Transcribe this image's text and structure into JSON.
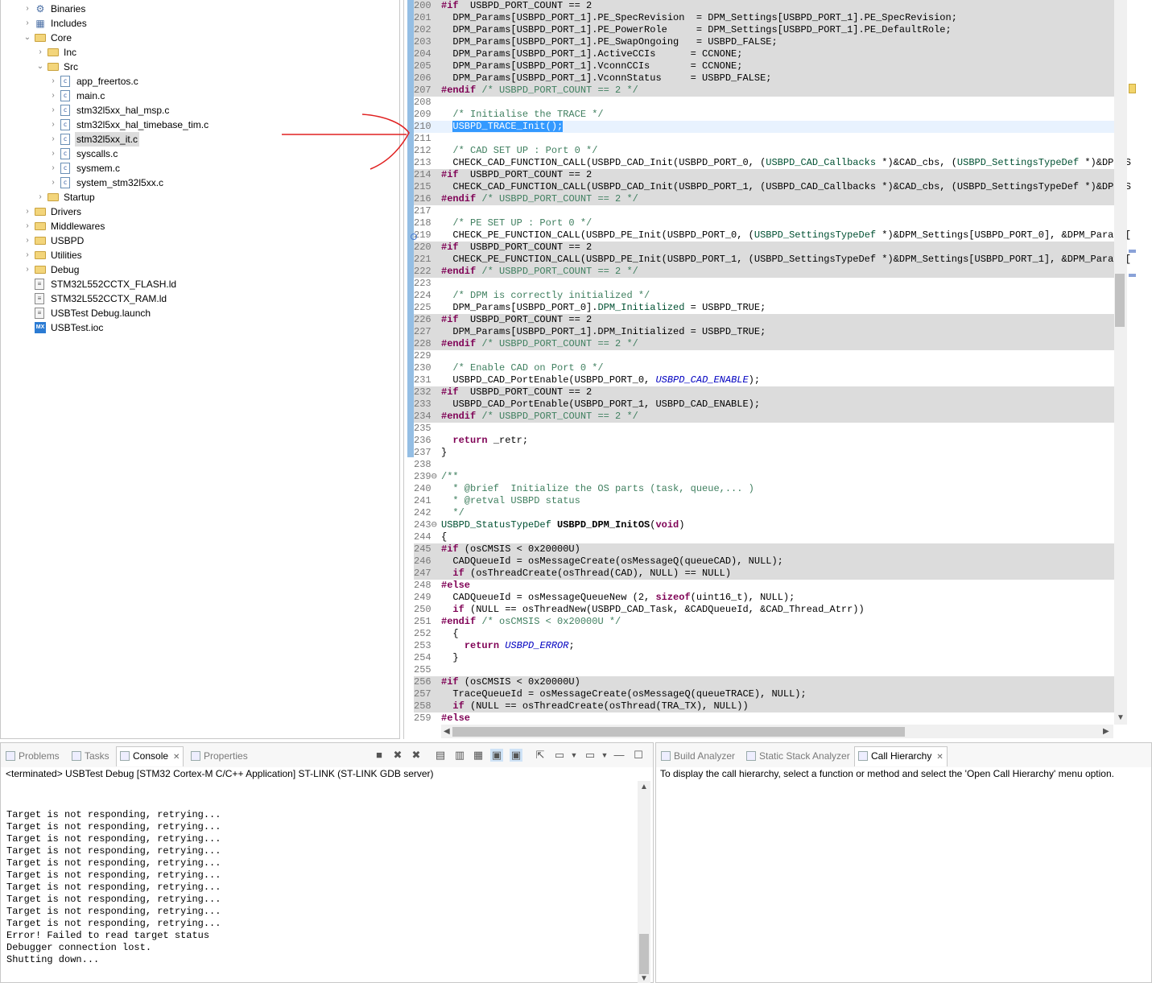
{
  "explorer": {
    "items": [
      {
        "label": "Binaries",
        "icon": "binaries-icon",
        "twisty": "closed"
      },
      {
        "label": "Includes",
        "icon": "includes-icon",
        "twisty": "closed"
      },
      {
        "label": "Core",
        "icon": "folder-icon",
        "twisty": "open"
      },
      {
        "label": "Inc",
        "icon": "folder-icon",
        "twisty": "closed"
      },
      {
        "label": "Src",
        "icon": "folder-icon",
        "twisty": "open"
      },
      {
        "label": "app_freertos.c",
        "icon": "c-file-icon",
        "twisty": "closed"
      },
      {
        "label": "main.c",
        "icon": "c-file-icon",
        "twisty": "closed"
      },
      {
        "label": "stm32l5xx_hal_msp.c",
        "icon": "c-file-icon",
        "twisty": "closed"
      },
      {
        "label": "stm32l5xx_hal_timebase_tim.c",
        "icon": "c-file-icon",
        "twisty": "closed"
      },
      {
        "label": "stm32l5xx_it.c",
        "icon": "c-file-icon",
        "twisty": "closed",
        "selected": true
      },
      {
        "label": "syscalls.c",
        "icon": "c-file-icon",
        "twisty": "closed"
      },
      {
        "label": "sysmem.c",
        "icon": "c-file-icon",
        "twisty": "closed"
      },
      {
        "label": "system_stm32l5xx.c",
        "icon": "c-file-icon",
        "twisty": "closed"
      },
      {
        "label": "Startup",
        "icon": "folder-icon",
        "twisty": "closed"
      },
      {
        "label": "Drivers",
        "icon": "folder-icon",
        "twisty": "closed"
      },
      {
        "label": "Middlewares",
        "icon": "folder-icon",
        "twisty": "closed"
      },
      {
        "label": "USBPD",
        "icon": "folder-icon",
        "twisty": "closed"
      },
      {
        "label": "Utilities",
        "icon": "folder-icon",
        "twisty": "closed"
      },
      {
        "label": "Debug",
        "icon": "folder-icon",
        "twisty": "closed"
      },
      {
        "label": "STM32L552CCTX_FLASH.ld",
        "icon": "linker-file-icon",
        "twisty": "none"
      },
      {
        "label": "STM32L552CCTX_RAM.ld",
        "icon": "linker-file-icon",
        "twisty": "none"
      },
      {
        "label": "USBTest Debug.launch",
        "icon": "launch-file-icon",
        "twisty": "none"
      },
      {
        "label": "USBTest.ioc",
        "icon": "mx-ioc-icon",
        "twisty": "none",
        "icon_text": "MX"
      }
    ]
  },
  "editor": {
    "lines": [
      {
        "n": "200",
        "inactive": true,
        "parts": [
          [
            "kw",
            "#if"
          ],
          [
            "",
            "  USBPD_PORT_COUNT == 2"
          ]
        ]
      },
      {
        "n": "201",
        "inactive": true,
        "parts": [
          [
            "",
            "  DPM_Params[USBPD_PORT_1].PE_SpecRevision  = DPM_Settings[USBPD_PORT_1].PE_SpecRevision;"
          ]
        ]
      },
      {
        "n": "202",
        "inactive": true,
        "parts": [
          [
            "",
            "  DPM_Params[USBPD_PORT_1].PE_PowerRole     = DPM_Settings[USBPD_PORT_1].PE_DefaultRole;"
          ]
        ]
      },
      {
        "n": "203",
        "inactive": true,
        "parts": [
          [
            "",
            "  DPM_Params[USBPD_PORT_1].PE_SwapOngoing   = USBPD_FALSE;"
          ]
        ]
      },
      {
        "n": "204",
        "inactive": true,
        "parts": [
          [
            "",
            "  DPM_Params[USBPD_PORT_1].ActiveCCIs      = CCNONE;"
          ]
        ]
      },
      {
        "n": "205",
        "inactive": true,
        "parts": [
          [
            "",
            "  DPM_Params[USBPD_PORT_1].VconnCCIs       = CCNONE;"
          ]
        ]
      },
      {
        "n": "206",
        "inactive": true,
        "parts": [
          [
            "",
            "  DPM_Params[USBPD_PORT_1].VconnStatus     = USBPD_FALSE;"
          ]
        ]
      },
      {
        "n": "207",
        "inactive": true,
        "parts": [
          [
            "kw",
            "#endif"
          ],
          [
            "cm",
            " /* USBPD_PORT_COUNT == 2 */"
          ]
        ]
      },
      {
        "n": "208",
        "parts": [
          [
            "",
            ""
          ]
        ]
      },
      {
        "n": "209",
        "parts": [
          [
            "cm",
            "  /* Initialise the TRACE */"
          ]
        ]
      },
      {
        "n": "210",
        "current": true,
        "parts": [
          [
            "",
            "  "
          ],
          [
            "sel",
            "USBPD_TRACE_Init();"
          ]
        ]
      },
      {
        "n": "211",
        "parts": [
          [
            "",
            ""
          ]
        ]
      },
      {
        "n": "212",
        "parts": [
          [
            "cm",
            "  /* CAD SET UP : Port 0 */"
          ]
        ]
      },
      {
        "n": "213",
        "parts": [
          [
            "",
            "  CHECK_CAD_FUNCTION_CALL(USBPD_CAD_Init(USBPD_PORT_0, ("
          ],
          [
            "ty",
            "USBPD_CAD_Callbacks"
          ],
          [
            "",
            " *)&CAD_cbs, ("
          ],
          [
            "ty",
            "USBPD_SettingsTypeDef"
          ],
          [
            "",
            " *)&DPM_S"
          ]
        ]
      },
      {
        "n": "214",
        "inactive": true,
        "parts": [
          [
            "kw",
            "#if"
          ],
          [
            "",
            "  USBPD_PORT_COUNT == 2"
          ]
        ]
      },
      {
        "n": "215",
        "inactive": true,
        "parts": [
          [
            "",
            "  CHECK_CAD_FUNCTION_CALL(USBPD_CAD_Init(USBPD_PORT_1, (USBPD_CAD_Callbacks *)&CAD_cbs, (USBPD_SettingsTypeDef *)&DPM_S"
          ]
        ]
      },
      {
        "n": "216",
        "inactive": true,
        "parts": [
          [
            "kw",
            "#endif"
          ],
          [
            "cm",
            " /* USBPD_PORT_COUNT == 2 */"
          ]
        ]
      },
      {
        "n": "217",
        "parts": [
          [
            "",
            ""
          ]
        ]
      },
      {
        "n": "218",
        "parts": [
          [
            "cm",
            "  /* PE SET UP : Port 0 */"
          ]
        ]
      },
      {
        "n": "219",
        "parts": [
          [
            "",
            "  CHECK_PE_FUNCTION_CALL(USBPD_PE_Init(USBPD_PORT_0, ("
          ],
          [
            "ty",
            "USBPD_SettingsTypeDef"
          ],
          [
            "",
            " *)&DPM_Settings[USBPD_PORT_0], &DPM_Params["
          ]
        ]
      },
      {
        "n": "220",
        "inactive": true,
        "parts": [
          [
            "kw",
            "#if"
          ],
          [
            "",
            "  USBPD_PORT_COUNT == 2"
          ]
        ]
      },
      {
        "n": "221",
        "inactive": true,
        "parts": [
          [
            "",
            "  CHECK_PE_FUNCTION_CALL(USBPD_PE_Init(USBPD_PORT_1, (USBPD_SettingsTypeDef *)&DPM_Settings[USBPD_PORT_1], &DPM_Params["
          ]
        ]
      },
      {
        "n": "222",
        "inactive": true,
        "parts": [
          [
            "kw",
            "#endif"
          ],
          [
            "cm",
            " /* USBPD_PORT_COUNT == 2 */"
          ]
        ]
      },
      {
        "n": "223",
        "parts": [
          [
            "",
            ""
          ]
        ]
      },
      {
        "n": "224",
        "parts": [
          [
            "cm",
            "  /* DPM is correctly initialized */"
          ]
        ]
      },
      {
        "n": "225",
        "parts": [
          [
            "",
            "  DPM_Params[USBPD_PORT_0]."
          ],
          [
            "mac2",
            "DPM_Initialized"
          ],
          [
            "",
            " = USBPD_TRUE;"
          ]
        ]
      },
      {
        "n": "226",
        "inactive": true,
        "parts": [
          [
            "kw",
            "#if"
          ],
          [
            "",
            "  USBPD_PORT_COUNT == 2"
          ]
        ]
      },
      {
        "n": "227",
        "inactive": true,
        "parts": [
          [
            "",
            "  DPM_Params[USBPD_PORT_1].DPM_Initialized = USBPD_TRUE;"
          ]
        ]
      },
      {
        "n": "228",
        "inactive": true,
        "parts": [
          [
            "kw",
            "#endif"
          ],
          [
            "cm",
            " /* USBPD_PORT_COUNT == 2 */"
          ]
        ]
      },
      {
        "n": "229",
        "parts": [
          [
            "",
            ""
          ]
        ]
      },
      {
        "n": "230",
        "parts": [
          [
            "cm",
            "  /* Enable CAD on Port 0 */"
          ]
        ]
      },
      {
        "n": "231",
        "parts": [
          [
            "",
            "  USBPD_CAD_PortEnable(USBPD_PORT_0, "
          ],
          [
            "mac",
            "USBPD_CAD_ENABLE"
          ],
          [
            "",
            ");"
          ]
        ]
      },
      {
        "n": "232",
        "inactive": true,
        "parts": [
          [
            "kw",
            "#if"
          ],
          [
            "",
            "  USBPD_PORT_COUNT == 2"
          ]
        ]
      },
      {
        "n": "233",
        "inactive": true,
        "parts": [
          [
            "",
            "  USBPD_CAD_PortEnable(USBPD_PORT_1, USBPD_CAD_ENABLE);"
          ]
        ]
      },
      {
        "n": "234",
        "inactive": true,
        "parts": [
          [
            "kw",
            "#endif"
          ],
          [
            "cm",
            " /* USBPD_PORT_COUNT == 2 */"
          ]
        ]
      },
      {
        "n": "235",
        "parts": [
          [
            "",
            ""
          ]
        ]
      },
      {
        "n": "236",
        "parts": [
          [
            "",
            "  "
          ],
          [
            "kw",
            "return"
          ],
          [
            "",
            " _retr;"
          ]
        ]
      },
      {
        "n": "237",
        "parts": [
          [
            "",
            "}"
          ]
        ]
      },
      {
        "n": "238",
        "parts": [
          [
            "",
            ""
          ]
        ]
      },
      {
        "n": "239⊖",
        "parts": [
          [
            "cm",
            "/**"
          ]
        ]
      },
      {
        "n": "240",
        "parts": [
          [
            "cm",
            "  * @brief  Initialize the OS parts (task, queue,... )"
          ]
        ]
      },
      {
        "n": "241",
        "parts": [
          [
            "cm",
            "  * @retval USBPD status"
          ]
        ]
      },
      {
        "n": "242",
        "parts": [
          [
            "cm",
            "  */"
          ]
        ]
      },
      {
        "n": "243⊖",
        "parts": [
          [
            "ty",
            "USBPD_StatusTypeDef"
          ],
          [
            "",
            " "
          ],
          [
            "bold",
            "USBPD_DPM_InitOS"
          ],
          [
            "",
            "("
          ],
          [
            "kw",
            "void"
          ],
          [
            "",
            ")"
          ]
        ]
      },
      {
        "n": "244",
        "parts": [
          [
            "",
            "{"
          ]
        ]
      },
      {
        "n": "245",
        "inactive": true,
        "parts": [
          [
            "kw",
            "#if"
          ],
          [
            "",
            " (osCMSIS < 0x20000U)"
          ]
        ]
      },
      {
        "n": "246",
        "inactive": true,
        "parts": [
          [
            "",
            "  CADQueueId = osMessageCreate(osMessageQ(queueCAD), NULL);"
          ]
        ]
      },
      {
        "n": "247",
        "inactive": true,
        "parts": [
          [
            "",
            "  "
          ],
          [
            "kw",
            "if"
          ],
          [
            "",
            " (osThreadCreate(osThread(CAD), NULL) == NULL)"
          ]
        ]
      },
      {
        "n": "248",
        "parts": [
          [
            "kw",
            "#else"
          ]
        ]
      },
      {
        "n": "249",
        "parts": [
          [
            "",
            "  CADQueueId = osMessageQueueNew (2, "
          ],
          [
            "kw",
            "sizeof"
          ],
          [
            "",
            "(uint16_t), NULL);"
          ]
        ]
      },
      {
        "n": "250",
        "parts": [
          [
            "",
            "  "
          ],
          [
            "kw",
            "if"
          ],
          [
            "",
            " (NULL == osThreadNew(USBPD_CAD_Task, &CADQueueId, &CAD_Thread_Atrr))"
          ]
        ]
      },
      {
        "n": "251",
        "parts": [
          [
            "kw",
            "#endif"
          ],
          [
            "cm",
            " /* osCMSIS < 0x20000U */"
          ]
        ]
      },
      {
        "n": "252",
        "parts": [
          [
            "",
            "  {"
          ]
        ]
      },
      {
        "n": "253",
        "parts": [
          [
            "",
            "    "
          ],
          [
            "kw",
            "return"
          ],
          [
            "",
            " "
          ],
          [
            "mac",
            "USBPD_ERROR"
          ],
          [
            "",
            ";"
          ]
        ]
      },
      {
        "n": "254",
        "parts": [
          [
            "",
            "  }"
          ]
        ]
      },
      {
        "n": "255",
        "parts": [
          [
            "",
            ""
          ]
        ]
      },
      {
        "n": "256",
        "inactive": true,
        "parts": [
          [
            "kw",
            "#if"
          ],
          [
            "",
            " (osCMSIS < 0x20000U)"
          ]
        ]
      },
      {
        "n": "257",
        "inactive": true,
        "parts": [
          [
            "",
            "  TraceQueueId = osMessageCreate(osMessageQ(queueTRACE), NULL);"
          ]
        ]
      },
      {
        "n": "258",
        "inactive": true,
        "parts": [
          [
            "",
            "  "
          ],
          [
            "kw",
            "if"
          ],
          [
            "",
            " (NULL == osThreadCreate(osThread(TRA_TX), NULL))"
          ]
        ]
      },
      {
        "n": "259",
        "parts": [
          [
            "kw",
            "#else"
          ]
        ]
      }
    ]
  },
  "bottom_left": {
    "tabs": [
      {
        "label": "Problems",
        "icon": "problems-icon",
        "active": false
      },
      {
        "label": "Tasks",
        "icon": "tasks-icon",
        "active": false
      },
      {
        "label": "Console",
        "icon": "console-icon",
        "active": true,
        "close": "✕"
      },
      {
        "label": "Properties",
        "icon": "properties-icon",
        "active": false
      }
    ],
    "status": "<terminated> USBTest Debug [STM32 Cortex-M C/C++ Application] ST-LINK (ST-LINK GDB server)",
    "output": [
      "Target is not responding, retrying...",
      "Target is not responding, retrying...",
      "Target is not responding, retrying...",
      "Target is not responding, retrying...",
      "Target is not responding, retrying...",
      "Target is not responding, retrying...",
      "Target is not responding, retrying...",
      "Target is not responding, retrying...",
      "Target is not responding, retrying...",
      "Target is not responding, retrying...",
      "Error! Failed to read target status",
      "Debugger connection lost.",
      "Shutting down..."
    ]
  },
  "bottom_right": {
    "tabs": [
      {
        "label": "Build Analyzer",
        "icon": "build-analyzer-icon",
        "active": false
      },
      {
        "label": "Static Stack Analyzer",
        "icon": "stack-analyzer-icon",
        "active": false
      },
      {
        "label": "Call Hierarchy",
        "icon": "call-hierarchy-icon",
        "active": true,
        "close": "✕"
      }
    ],
    "message": "To display the call hierarchy, select a function or method and select the 'Open Call Hierarchy' menu option."
  },
  "colors": {
    "annotation_arrow": "#e02020",
    "selection": "#3399ff",
    "keyword": "#7f0055",
    "comment": "#3f7f5f"
  }
}
